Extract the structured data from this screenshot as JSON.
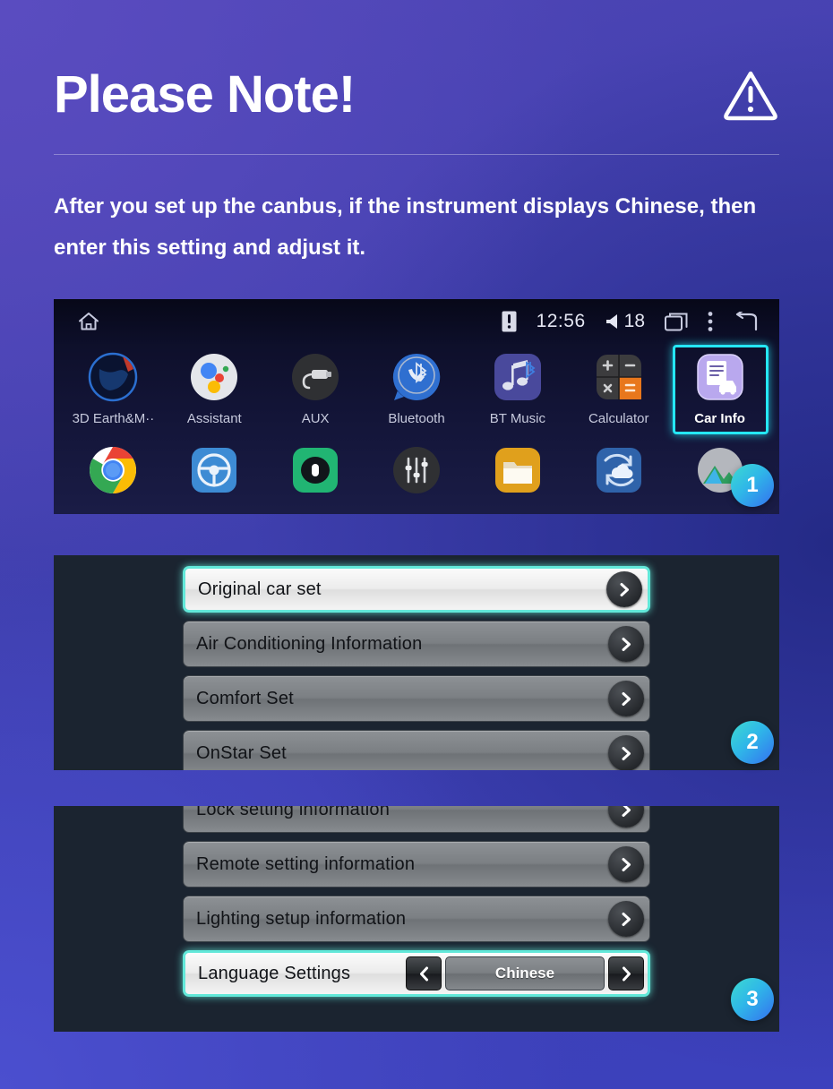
{
  "header": {
    "title": "Please Note!",
    "icon": "warning-triangle-icon"
  },
  "intro": {
    "text": "After you set up the canbus, if the instrument displays Chinese, then enter this setting and adjust it."
  },
  "launcher": {
    "statusbar": {
      "home_icon": "home-icon",
      "warning_icon": "warning-badge-icon",
      "clock": "12:56",
      "volume_icon": "volume-icon",
      "volume": "18",
      "recents_icon": "recents-icon",
      "overflow_icon": "more-vertical-icon",
      "back_icon": "back-arrow-icon"
    },
    "row1": [
      {
        "label": "3D Earth&M··",
        "icon": "earth-icon",
        "selected": false
      },
      {
        "label": "Assistant",
        "icon": "assistant-icon",
        "selected": false
      },
      {
        "label": "AUX",
        "icon": "aux-plug-icon",
        "selected": false
      },
      {
        "label": "Bluetooth",
        "icon": "bluetooth-phone-icon",
        "selected": false
      },
      {
        "label": "BT Music",
        "icon": "bt-music-icon",
        "selected": false
      },
      {
        "label": "Calculator",
        "icon": "calculator-icon",
        "selected": false
      },
      {
        "label": "Car Info",
        "icon": "car-info-icon",
        "selected": true
      }
    ],
    "row2": [
      {
        "label": "",
        "icon": "chrome-icon"
      },
      {
        "label": "",
        "icon": "steering-wheel-icon"
      },
      {
        "label": "",
        "icon": "recorder-icon"
      },
      {
        "label": "",
        "icon": "equalizer-icon"
      },
      {
        "label": "",
        "icon": "folder-icon"
      },
      {
        "label": "",
        "icon": "cloud-sync-icon"
      },
      {
        "label": "",
        "icon": "gallery-icon"
      }
    ]
  },
  "panel2": {
    "rows": [
      {
        "label": "Original car set",
        "highlighted": true
      },
      {
        "label": "Air Conditioning Information",
        "highlighted": false
      },
      {
        "label": "Comfort Set",
        "highlighted": false
      },
      {
        "label": "OnStar Set",
        "highlighted": false
      }
    ]
  },
  "panel3": {
    "rows": [
      {
        "label": "Lock setting information",
        "highlighted": false
      },
      {
        "label": "Remote setting information",
        "highlighted": false
      },
      {
        "label": "Lighting setup information",
        "highlighted": false
      }
    ],
    "language_row": {
      "label": "Language Settings",
      "value": "Chinese",
      "prev_icon": "chevron-left-icon",
      "next_icon": "chevron-right-icon",
      "highlighted": true
    }
  },
  "badges": {
    "one": "1",
    "two": "2",
    "three": "3"
  },
  "colors": {
    "accent_cyan": "#25e7f5",
    "highlight_border": "#62e8d9",
    "badge_start": "#3ddbd0",
    "badge_end": "#3470f0",
    "panel_bg": "#1b2430"
  }
}
